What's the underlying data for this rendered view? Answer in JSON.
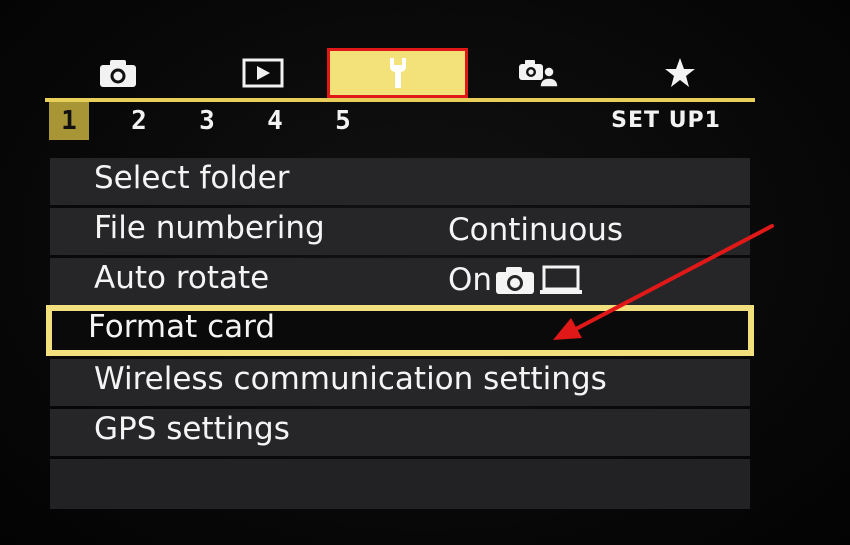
{
  "categories": [
    {
      "id": "shooting",
      "icon": "camera-icon"
    },
    {
      "id": "playback",
      "icon": "playback-icon"
    },
    {
      "id": "setup",
      "icon": "wrench-icon",
      "active": true
    },
    {
      "id": "custom",
      "icon": "custom-functions-icon"
    },
    {
      "id": "mymenu",
      "icon": "star-icon"
    }
  ],
  "subtabs": [
    "1",
    "2",
    "3",
    "4",
    "5"
  ],
  "active_subtab": "1",
  "page_label": "SET UP1",
  "menu": {
    "items": [
      {
        "label": "Select folder",
        "value": ""
      },
      {
        "label": "File numbering",
        "value": "Continuous"
      },
      {
        "label": "Auto rotate",
        "value": "On"
      },
      {
        "label": "Format card",
        "value": ""
      },
      {
        "label": "Wireless communication settings",
        "value": ""
      },
      {
        "label": "GPS settings",
        "value": ""
      }
    ],
    "selected_index": 3
  },
  "colors": {
    "accent_yellow": "#f3e27a",
    "highlight_red": "#e01818",
    "subtab_active": "#a89636"
  }
}
